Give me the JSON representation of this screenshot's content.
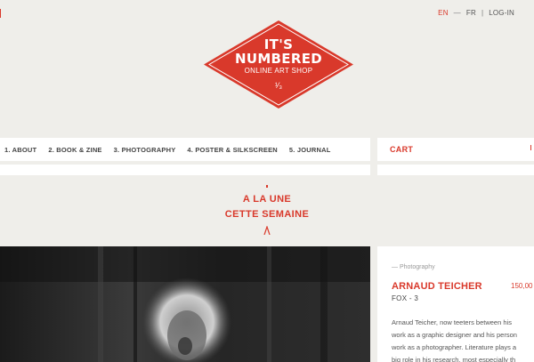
{
  "language_bar": {
    "active": "EN",
    "separator": "—",
    "other": "FR",
    "login": "LOG-IN"
  },
  "logo": {
    "line1": "IT'S",
    "line2": "NUMBERED",
    "line3": "ONLINE ART SHOP",
    "line4": "¹⁄₃"
  },
  "nav": {
    "items": [
      {
        "label": "1. ABOUT"
      },
      {
        "label": "2. BOOK & ZINE"
      },
      {
        "label": "3. PHOTOGRAPHY"
      },
      {
        "label": "4. POSTER & SILKSCREEN"
      },
      {
        "label": "5. JOURNAL"
      }
    ]
  },
  "cart": {
    "label": "CART"
  },
  "feature": {
    "line1": "A LA UNE",
    "line2": "CETTE SEMAINE"
  },
  "product": {
    "category": "— Photography",
    "artist": "ARNAUD TEICHER",
    "price": "150,00",
    "title": "FOX - 3",
    "desc_lines": [
      "Arnaud Teicher, now teeters between his",
      "work as a graphic designer and his person",
      "work as a photographer. Literature plays a",
      "big role in his research, most especially th"
    ]
  },
  "colors": {
    "accent": "#d9392b",
    "background": "#efeeea"
  }
}
